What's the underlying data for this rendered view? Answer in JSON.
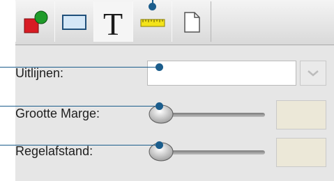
{
  "toolbar": {
    "tabs": [
      {
        "name": "shape-tool",
        "icon": "shape-icon"
      },
      {
        "name": "rectangle-tool",
        "icon": "rectangle-icon"
      },
      {
        "name": "text-tool",
        "icon": "text-icon",
        "active": true
      },
      {
        "name": "ruler-tool",
        "icon": "ruler-icon"
      },
      {
        "name": "page-tool",
        "icon": "page-icon"
      }
    ]
  },
  "form": {
    "align_label": "Uitlijnen:",
    "align_value": "",
    "margin_label": "Grootte Marge:",
    "margin_slider_value": 0,
    "margin_value": "",
    "spacing_label": "Regelafstand:",
    "spacing_slider_value": 0,
    "spacing_value": ""
  }
}
